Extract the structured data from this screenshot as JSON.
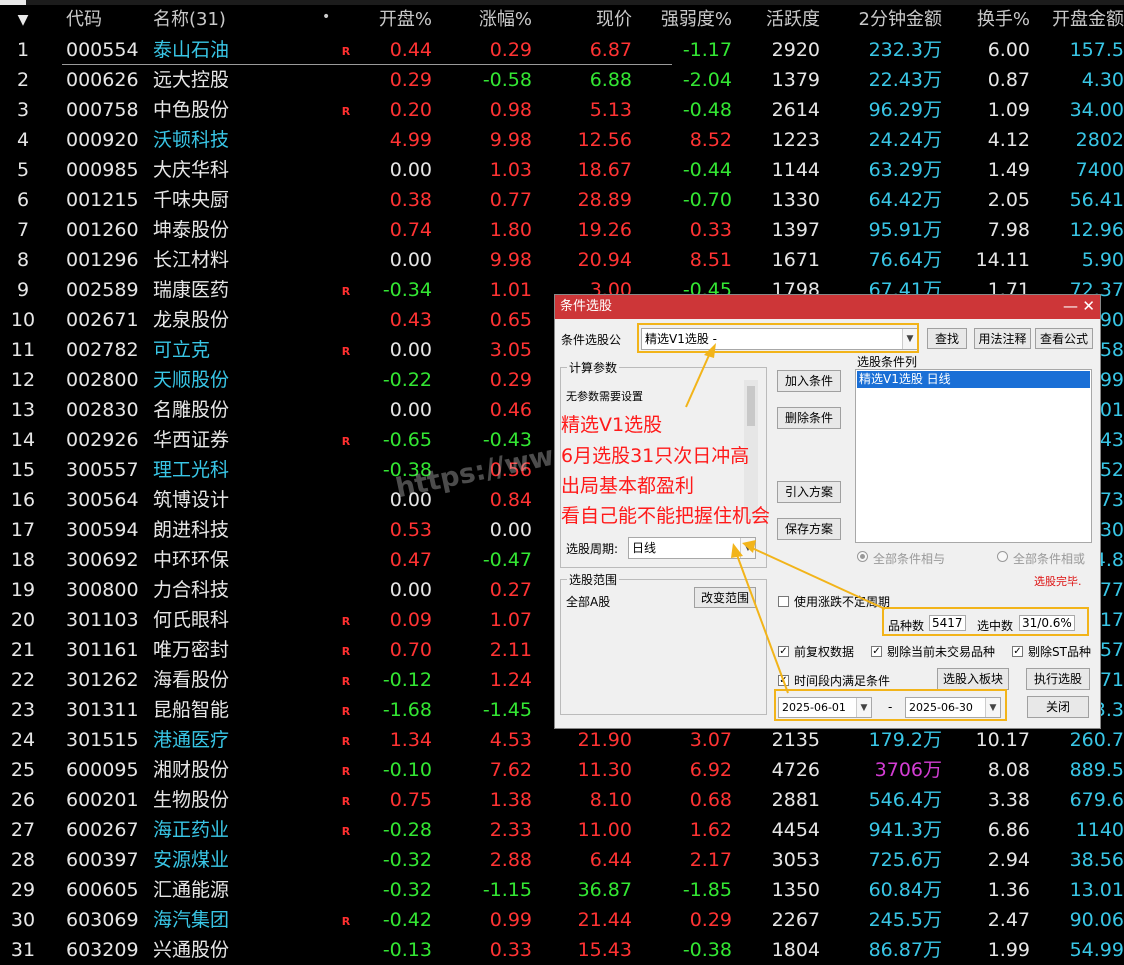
{
  "header": {
    "cols": [
      "代码",
      "名称(31)",
      "开盘%",
      "涨幅%",
      "现价",
      "强弱度%",
      "活跃度",
      "2分钟金额",
      "换手%",
      "开盘金额"
    ],
    "sort_marker": "▼",
    "dot": "•"
  },
  "rows": [
    {
      "idx": "1",
      "code": "000554",
      "name": "泰山石油",
      "name_color": "cyan",
      "r": "R",
      "open": "0.44",
      "open_c": "red",
      "chg": "0.29",
      "chg_c": "red",
      "price": "6.87",
      "price_c": "red",
      "str": "-1.17",
      "str_c": "green",
      "act": "2920",
      "amt": "232.3万",
      "turn": "6.00",
      "oamt": "157.5"
    },
    {
      "idx": "2",
      "code": "000626",
      "name": "远大控股",
      "name_color": "white",
      "r": "",
      "open": "0.29",
      "open_c": "red",
      "chg": "-0.58",
      "chg_c": "green",
      "price": "6.88",
      "price_c": "green",
      "str": "-2.04",
      "str_c": "green",
      "act": "1379",
      "amt": "22.43万",
      "turn": "0.87",
      "oamt": "4.30"
    },
    {
      "idx": "3",
      "code": "000758",
      "name": "中色股份",
      "name_color": "white",
      "r": "R",
      "open": "0.20",
      "open_c": "red",
      "chg": "0.98",
      "chg_c": "red",
      "price": "5.13",
      "price_c": "red",
      "str": "-0.48",
      "str_c": "green",
      "act": "2614",
      "amt": "96.29万",
      "turn": "1.09",
      "oamt": "34.00"
    },
    {
      "idx": "4",
      "code": "000920",
      "name": "沃顿科技",
      "name_color": "cyan",
      "r": "",
      "open": "4.99",
      "open_c": "red",
      "chg": "9.98",
      "chg_c": "red",
      "price": "12.56",
      "price_c": "red",
      "str": "8.52",
      "str_c": "red",
      "act": "1223",
      "amt": "24.24万",
      "turn": "4.12",
      "oamt": "2802"
    },
    {
      "idx": "5",
      "code": "000985",
      "name": "大庆华科",
      "name_color": "white",
      "r": "",
      "open": "0.00",
      "open_c": "white",
      "chg": "1.03",
      "chg_c": "red",
      "price": "18.67",
      "price_c": "red",
      "str": "-0.44",
      "str_c": "green",
      "act": "1144",
      "amt": "63.29万",
      "turn": "1.49",
      "oamt": "7400"
    },
    {
      "idx": "6",
      "code": "001215",
      "name": "千味央厨",
      "name_color": "white",
      "r": "",
      "open": "0.38",
      "open_c": "red",
      "chg": "0.77",
      "chg_c": "red",
      "price": "28.89",
      "price_c": "red",
      "str": "-0.70",
      "str_c": "green",
      "act": "1330",
      "amt": "64.42万",
      "turn": "2.05",
      "oamt": "56.41"
    },
    {
      "idx": "7",
      "code": "001260",
      "name": "坤泰股份",
      "name_color": "white",
      "r": "",
      "open": "0.74",
      "open_c": "red",
      "chg": "1.80",
      "chg_c": "red",
      "price": "19.26",
      "price_c": "red",
      "str": "0.33",
      "str_c": "red",
      "act": "1397",
      "amt": "95.91万",
      "turn": "7.98",
      "oamt": "12.96"
    },
    {
      "idx": "8",
      "code": "001296",
      "name": "长江材料",
      "name_color": "white",
      "r": "",
      "open": "0.00",
      "open_c": "white",
      "chg": "9.98",
      "chg_c": "red",
      "price": "20.94",
      "price_c": "red",
      "str": "8.51",
      "str_c": "red",
      "act": "1671",
      "amt": "76.64万",
      "turn": "14.11",
      "oamt": "5.90"
    },
    {
      "idx": "9",
      "code": "002589",
      "name": "瑞康医药",
      "name_color": "white",
      "r": "R",
      "open": "-0.34",
      "open_c": "green",
      "chg": "1.01",
      "chg_c": "red",
      "price": "3.00",
      "price_c": "red",
      "str": "-0.45",
      "str_c": "green",
      "act": "1798",
      "amt": "67.41万",
      "turn": "1.71",
      "oamt": "72.37"
    },
    {
      "idx": "10",
      "code": "002671",
      "name": "龙泉股份",
      "name_color": "white",
      "r": "",
      "open": "0.43",
      "open_c": "red",
      "chg": "0.65",
      "chg_c": "red",
      "price": "",
      "price_c": "red",
      "str": "",
      "str_c": "red",
      "act": "",
      "amt": "",
      "turn": "",
      "oamt": "90"
    },
    {
      "idx": "11",
      "code": "002782",
      "name": "可立克",
      "name_color": "cyan",
      "r": "R",
      "open": "0.00",
      "open_c": "white",
      "chg": "3.05",
      "chg_c": "red",
      "price": "",
      "price_c": "red",
      "str": "",
      "str_c": "red",
      "act": "",
      "amt": "",
      "turn": "",
      "oamt": "58"
    },
    {
      "idx": "12",
      "code": "002800",
      "name": "天顺股份",
      "name_color": "cyan",
      "r": "",
      "open": "-0.22",
      "open_c": "green",
      "chg": "0.29",
      "chg_c": "red",
      "price": "",
      "price_c": "red",
      "str": "",
      "str_c": "red",
      "act": "",
      "amt": "",
      "turn": "",
      "oamt": "99"
    },
    {
      "idx": "13",
      "code": "002830",
      "name": "名雕股份",
      "name_color": "white",
      "r": "",
      "open": "0.00",
      "open_c": "white",
      "chg": "0.46",
      "chg_c": "red",
      "price": "",
      "price_c": "red",
      "str": "",
      "str_c": "red",
      "act": "",
      "amt": "",
      "turn": "",
      "oamt": "01"
    },
    {
      "idx": "14",
      "code": "002926",
      "name": "华西证券",
      "name_color": "white",
      "r": "R",
      "open": "-0.65",
      "open_c": "green",
      "chg": "-0.43",
      "chg_c": "green",
      "price": "",
      "price_c": "red",
      "str": "",
      "str_c": "red",
      "act": "",
      "amt": "",
      "turn": "",
      "oamt": "43"
    },
    {
      "idx": "15",
      "code": "300557",
      "name": "理工光科",
      "name_color": "cyan",
      "r": "",
      "open": "-0.38",
      "open_c": "green",
      "chg": "0.56",
      "chg_c": "red",
      "price": "",
      "price_c": "red",
      "str": "",
      "str_c": "red",
      "act": "",
      "amt": "",
      "turn": "",
      "oamt": "52"
    },
    {
      "idx": "16",
      "code": "300564",
      "name": "筑博设计",
      "name_color": "white",
      "r": "",
      "open": "0.00",
      "open_c": "white",
      "chg": "0.84",
      "chg_c": "red",
      "price": "",
      "price_c": "red",
      "str": "",
      "str_c": "red",
      "act": "",
      "amt": "",
      "turn": "",
      "oamt": "73"
    },
    {
      "idx": "17",
      "code": "300594",
      "name": "朗进科技",
      "name_color": "white",
      "r": "",
      "open": "0.53",
      "open_c": "red",
      "chg": "0.00",
      "chg_c": "white",
      "price": "",
      "price_c": "red",
      "str": "",
      "str_c": "red",
      "act": "",
      "amt": "",
      "turn": "",
      "oamt": "30"
    },
    {
      "idx": "18",
      "code": "300692",
      "name": "中环环保",
      "name_color": "white",
      "r": "",
      "open": "0.47",
      "open_c": "red",
      "chg": "-0.47",
      "chg_c": "green",
      "price": "",
      "price_c": "red",
      "str": "",
      "str_c": "red",
      "act": "",
      "amt": "",
      "turn": "",
      "oamt": "4.8"
    },
    {
      "idx": "19",
      "code": "300800",
      "name": "力合科技",
      "name_color": "white",
      "r": "",
      "open": "0.00",
      "open_c": "white",
      "chg": "0.27",
      "chg_c": "red",
      "price": "",
      "price_c": "red",
      "str": "",
      "str_c": "red",
      "act": "",
      "amt": "",
      "turn": "",
      "oamt": "77"
    },
    {
      "idx": "20",
      "code": "301103",
      "name": "何氏眼科",
      "name_color": "white",
      "r": "R",
      "open": "0.09",
      "open_c": "red",
      "chg": "1.07",
      "chg_c": "red",
      "price": "",
      "price_c": "red",
      "str": "",
      "str_c": "red",
      "act": "",
      "amt": "",
      "turn": "",
      "oamt": "17"
    },
    {
      "idx": "21",
      "code": "301161",
      "name": "唯万密封",
      "name_color": "white",
      "r": "R",
      "open": "0.70",
      "open_c": "red",
      "chg": "2.11",
      "chg_c": "red",
      "price": "",
      "price_c": "red",
      "str": "",
      "str_c": "red",
      "act": "",
      "amt": "",
      "turn": "",
      "oamt": "57"
    },
    {
      "idx": "22",
      "code": "301262",
      "name": "海看股份",
      "name_color": "white",
      "r": "R",
      "open": "-0.12",
      "open_c": "green",
      "chg": "1.24",
      "chg_c": "red",
      "price": "",
      "price_c": "red",
      "str": "",
      "str_c": "red",
      "act": "",
      "amt": "",
      "turn": "",
      "oamt": "71"
    },
    {
      "idx": "23",
      "code": "301311",
      "name": "昆船智能",
      "name_color": "white",
      "r": "R",
      "open": "-1.68",
      "open_c": "green",
      "chg": "-1.45",
      "chg_c": "green",
      "price": "",
      "price_c": "red",
      "str": "",
      "str_c": "red",
      "act": "",
      "amt": "",
      "turn": "",
      "oamt": "3.3"
    },
    {
      "idx": "24",
      "code": "301515",
      "name": "港通医疗",
      "name_color": "cyan",
      "r": "R",
      "open": "1.34",
      "open_c": "red",
      "chg": "4.53",
      "chg_c": "red",
      "price": "21.90",
      "price_c": "red",
      "str": "3.07",
      "str_c": "red",
      "act": "2135",
      "amt": "179.2万",
      "turn": "10.17",
      "oamt": "260.7"
    },
    {
      "idx": "25",
      "code": "600095",
      "name": "湘财股份",
      "name_color": "white",
      "r": "R",
      "open": "-0.10",
      "open_c": "green",
      "chg": "7.62",
      "chg_c": "red",
      "price": "11.30",
      "price_c": "red",
      "str": "6.92",
      "str_c": "red",
      "act": "4726",
      "amt": "3706万",
      "amt_c": "magenta",
      "turn": "8.08",
      "oamt": "889.5"
    },
    {
      "idx": "26",
      "code": "600201",
      "name": "生物股份",
      "name_color": "white",
      "r": "R",
      "open": "0.75",
      "open_c": "red",
      "chg": "1.38",
      "chg_c": "red",
      "price": "8.10",
      "price_c": "red",
      "str": "0.68",
      "str_c": "red",
      "act": "2881",
      "amt": "546.4万",
      "turn": "3.38",
      "oamt": "679.6"
    },
    {
      "idx": "27",
      "code": "600267",
      "name": "海正药业",
      "name_color": "cyan",
      "r": "R",
      "open": "-0.28",
      "open_c": "green",
      "chg": "2.33",
      "chg_c": "red",
      "price": "11.00",
      "price_c": "red",
      "str": "1.62",
      "str_c": "red",
      "act": "4454",
      "amt": "941.3万",
      "turn": "6.86",
      "oamt": "1140"
    },
    {
      "idx": "28",
      "code": "600397",
      "name": "安源煤业",
      "name_color": "cyan",
      "r": "",
      "open": "-0.32",
      "open_c": "green",
      "chg": "2.88",
      "chg_c": "red",
      "price": "6.44",
      "price_c": "red",
      "str": "2.17",
      "str_c": "red",
      "act": "3053",
      "amt": "725.6万",
      "turn": "2.94",
      "oamt": "38.56"
    },
    {
      "idx": "29",
      "code": "600605",
      "name": "汇通能源",
      "name_color": "white",
      "r": "",
      "open": "-0.32",
      "open_c": "green",
      "chg": "-1.15",
      "chg_c": "green",
      "price": "36.87",
      "price_c": "green",
      "str": "-1.85",
      "str_c": "green",
      "act": "1350",
      "amt": "60.84万",
      "turn": "1.36",
      "oamt": "13.01"
    },
    {
      "idx": "30",
      "code": "603069",
      "name": "海汽集团",
      "name_color": "cyan",
      "r": "R",
      "open": "-0.42",
      "open_c": "green",
      "chg": "0.99",
      "chg_c": "red",
      "price": "21.44",
      "price_c": "red",
      "str": "0.29",
      "str_c": "red",
      "act": "2267",
      "amt": "245.5万",
      "turn": "2.47",
      "oamt": "90.06"
    },
    {
      "idx": "31",
      "code": "603209",
      "name": "兴通股份",
      "name_color": "white",
      "r": "",
      "open": "-0.13",
      "open_c": "green",
      "chg": "0.33",
      "chg_c": "red",
      "price": "15.43",
      "price_c": "red",
      "str": "-0.38",
      "str_c": "green",
      "act": "1804",
      "amt": "86.87万",
      "turn": "1.99",
      "oamt": "54.99"
    }
  ],
  "watermark": "https://ww",
  "dialog": {
    "title": "条件选股",
    "min_btn": "—",
    "close_btn": "✕",
    "formula_label": "条件选股公",
    "formula_value": "精选V1选股  -",
    "find_btn": "查找",
    "usage_btn": "用法注释",
    "view_btn": "查看公式",
    "params_group": "计算参数",
    "no_params": "无参数需要设置",
    "add_btn": "加入条件",
    "delete_btn": "删除条件",
    "import_btn": "引入方案",
    "save_btn": "保存方案",
    "cond_list_label": "选股条件列",
    "cond_item": "精选V1选股  日线",
    "period_label": "选股周期:",
    "period_value": "日线",
    "radio_all": "全部条件相与",
    "radio_any": "全部条件相或",
    "done_text": "选股完毕.",
    "range_group": "选股范围",
    "range_value": "全部A股",
    "change_range_btn": "改变范围",
    "use_uncertain": "使用涨跌不定周期",
    "count_label": "品种数",
    "count_value": "5417",
    "selected_label": "选中数",
    "selected_value": "31/0.6%",
    "opt_prev": "前复权数据",
    "opt_no_trade": "剔除当前未交易品种",
    "opt_st": "剔除ST品种",
    "opt_timeslot": "时间段内满足条件",
    "to_block_btn": "选股入板块",
    "exec_btn": "执行选股",
    "date_from": "2025-06-01",
    "date_sep": "-",
    "date_to": "2025-06-30",
    "close_btn_label": "关闭"
  },
  "annotation": {
    "line1": "精选V1选股",
    "line2": "6月选股31只次日冲高",
    "line3": "出局基本都盈利",
    "line4": "看自己能不能把握住机会"
  },
  "colors": {
    "red": "#ff3333",
    "green": "#33e633",
    "cyan": "#39c6e6",
    "highlight": "#f2b41a",
    "title_bar": "#cd3638"
  }
}
